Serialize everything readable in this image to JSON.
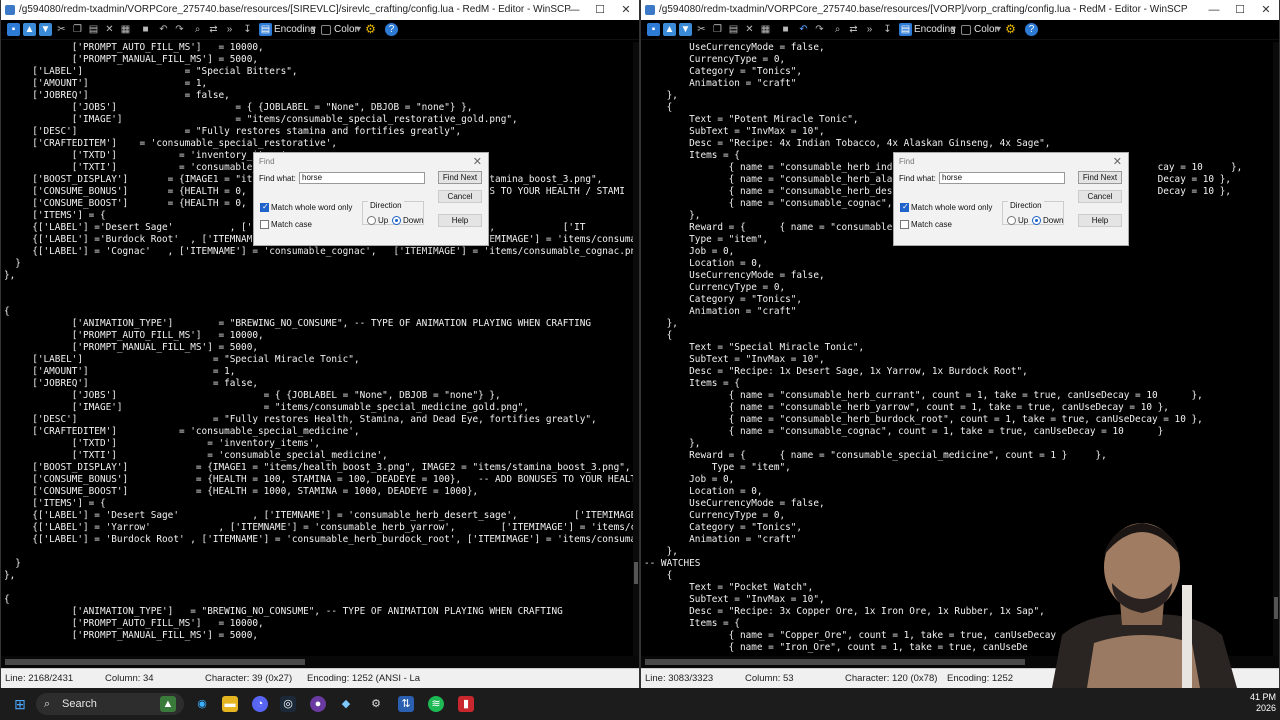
{
  "left_window": {
    "title": "/g594080/redm-txadmin/VORPCore_275740.base/resources/[SIREVLC]/sirevlc_crafting/config.lua - RedM - Editor - WinSCP",
    "toolbar": {
      "encoding_label": "Encoding",
      "color_label": "Color"
    },
    "code_lines": [
      "            ['PROMPT_AUTO_FILL_MS']   = 10000,",
      "            ['PROMPT_MANUAL_FILL_MS'] = 5000,",
      "     ['LABEL']                  = \"Special Bitters\",",
      "     ['AMOUNT']                 = 1,",
      "     ['JOBREQ']                 = false,",
      "            ['JOBS']                     = { {JOBLABEL = \"None\", DBJOB = \"none\"} },",
      "            ['IMAGE']                    = \"items/consumable_special_restorative_gold.png\",",
      "     ['DESC']                   = \"Fully restores stamina and fortifies greatly\",",
      "     ['CRAFTEDITEM']    = 'consumable_special_restorative',",
      "            ['TXTD']           = 'inventory_items',",
      "            ['TXTI']           = 'consumable_special_restorative',",
      "     ['BOOST_DISPLAY']       = {IMAGE1 = \"items/health_boost_3.png\", IMAGE2 = \"items/stamina_boost_3.png\",",
      "     ['CONSUME_BONUS']       = {HEALTH = 0, STAMINA = 100, DEADEYE = 0}, -- ADD BONUSES TO YOUR HEALTH / STAMI",
      "     ['CONSUME_BOOST']       = {HEALTH = 0, STAMINA = 1000, DEADEYE = 0},",
      "     ['ITEMS'] = {",
      "     {['LABEL'] ='Desert Sage'          , ['ITEMNAME'] = 'consumable_herb_desert_sage',            ['IT",
      "     {['LABEL'] ='Burdock Root'  , ['ITEMNAME'] = 'consumable_herb_burdock_root', ['ITEMIMAGE'] = 'items/consumabl",
      "     {['LABEL'] = 'Cognac'   , ['ITEMNAME'] = 'consumable_cognac',   ['ITEMIMAGE'] = 'items/consumable_cognac.png",
      "  }",
      "},",
      "",
      "",
      "{",
      "            ['ANIMATION_TYPE']        = \"BREWING_NO_CONSUME\", -- TYPE OF ANIMATION PLAYING WHEN CRAFTING",
      "            ['PROMPT_AUTO_FILL_MS']   = 10000,",
      "            ['PROMPT_MANUAL_FILL_MS'] = 5000,",
      "     ['LABEL']                       = \"Special Miracle Tonic\",",
      "     ['AMOUNT']                      = 1,",
      "     ['JOBREQ']                      = false,",
      "            ['JOBS']                          = { {JOBLABEL = \"None\", DBJOB = \"none\"} },",
      "            ['IMAGE']                         = \"items/consumable_special_medicine_gold.png\",",
      "     ['DESC']                        = \"Fully restores Health, Stamina, and Dead Eye, fortifies greatly\",",
      "     ['CRAFTEDITEM']           = 'consumable_special_medicine',",
      "            ['TXTD']                = 'inventory_items',",
      "            ['TXTI']                = 'consumable_special_medicine',",
      "     ['BOOST_DISPLAY']            = {IMAGE1 = \"items/health_boost_3.png\", IMAGE2 = \"items/stamina_boost_3.png\", I",
      "     ['CONSUME_BONUS']            = {HEALTH = 100, STAMINA = 100, DEADEYE = 100},   -- ADD BONUSES TO YOUR HEALTH",
      "     ['CONSUME_BOOST']            = {HEALTH = 1000, STAMINA = 1000, DEADEYE = 1000},",
      "     ['ITEMS'] = {",
      "     {['LABEL'] = 'Desert Sage'             , ['ITEMNAME'] = 'consumable_herb_desert_sage',          ['ITEMIMAGE'",
      "     {['LABEL'] = 'Yarrow'            , ['ITEMNAME'] = 'consumable_herb_yarrow',        ['ITEMIMAGE'] = 'items/consu",
      "     {['LABEL'] = 'Burdock Root' , ['ITEMNAME'] = 'consumable_herb_burdock_root', ['ITEMIMAGE'] = 'items/consumabl",
      "",
      "  }",
      "},",
      "",
      "{",
      "            ['ANIMATION_TYPE']   = \"BREWING_NO_CONSUME\", -- TYPE OF ANIMATION PLAYING WHEN CRAFTING",
      "            ['PROMPT_AUTO_FILL_MS']   = 10000,",
      "            ['PROMPT_MANUAL_FILL_MS'] = 5000,"
    ],
    "status": {
      "line": "Line: 2168/2431",
      "column": "Column: 34",
      "character": "Character: 39 (0x27)",
      "encoding": "Encoding: 1252  (ANSI - La"
    }
  },
  "right_window": {
    "title": "/g594080/redm-txadmin/VORPCore_275740.base/resources/[VORP]/vorp_crafting/config.lua - RedM - Editor - WinSCP",
    "toolbar": {
      "encoding_label": "Encoding",
      "color_label": "Color"
    },
    "code_lines": [
      "        UseCurrencyMode = false,",
      "        CurrencyType = 0,",
      "        Category = \"Tonics\",",
      "        Animation = \"craft\"",
      "    },",
      "    {",
      "        Text = \"Potent Miracle Tonic\",",
      "        SubText = \"InvMax = 10\",",
      "        Desc = \"Recipe: 4x Indian Tobacco, 4x Alaskan Ginseng, 4x Sage\",",
      "        Items = {",
      "               { name = \"consumable_herb_india                                             cay = 10     },",
      "               { name = \"consumable_herb_alask                                             Decay = 10 },",
      "               { name = \"consumable_herb_deser                                             Decay = 10 },",
      "               { name = \"consumable_cognac\", c",
      "        },",
      "        Reward = {      { name = \"consumable",
      "        Type = \"item\",",
      "        Job = 0,",
      "        Location = 0,",
      "        UseCurrencyMode = false,",
      "        CurrencyType = 0,",
      "        Category = \"Tonics\",",
      "        Animation = \"craft\"",
      "    },",
      "    {",
      "        Text = \"Special Miracle Tonic\",",
      "        SubText = \"InvMax = 10\",",
      "        Desc = \"Recipe: 1x Desert Sage, 1x Yarrow, 1x Burdock Root\",",
      "        Items = {",
      "               { name = \"consumable_herb_currant\", count = 1, take = true, canUseDecay = 10      },",
      "               { name = \"consumable_herb_yarrow\", count = 1, take = true, canUseDecay = 10 },",
      "               { name = \"consumable_herb_burdock_root\", count = 1, take = true, canUseDecay = 10 },",
      "               { name = \"consumable_cognac\", count = 1, take = true, canUseDecay = 10      }",
      "        },",
      "        Reward = {      { name = \"consumable_special_medicine\", count = 1 }     },",
      "            Type = \"item\",",
      "        Job = 0,",
      "        Location = 0,",
      "        UseCurrencyMode = false,",
      "        CurrencyType = 0,",
      "        Category = \"Tonics\",",
      "        Animation = \"craft\"",
      "    },",
      "-- WATCHES",
      "    {",
      "        Text = \"Pocket Watch\",",
      "        SubText = \"InvMax = 10\",",
      "        Desc = \"Recipe: 3x Copper Ore, 1x Iron Ore, 1x Rubber, 1x Sap\",",
      "        Items = {",
      "               { name = \"Copper_Ore\", count = 1, take = true, canUseDecay",
      "               { name = \"Iron_Ore\", count = 1, take = true, canUseDe"
    ],
    "status": {
      "line": "Line: 3083/3323",
      "column": "Column: 53",
      "character": "Character: 120 (0x78)",
      "encoding": "Encoding: 1252"
    }
  },
  "find_dialog": {
    "title": "Find",
    "find_what_label": "Find what:",
    "find_what_value": "horse",
    "find_next": "Find Next",
    "cancel": "Cancel",
    "help": "Help",
    "match_whole_word": "Match whole word only",
    "match_case": "Match case",
    "direction_label": "Direction",
    "up": "Up",
    "down": "Down"
  },
  "taskbar": {
    "search_label": "Search",
    "clock_time": "41 PM",
    "clock_date": "2026"
  },
  "colors": {
    "selection": "#1f4fb8",
    "background": "#000000",
    "text": "#f2f2f2",
    "accent": "#1e63c7"
  }
}
